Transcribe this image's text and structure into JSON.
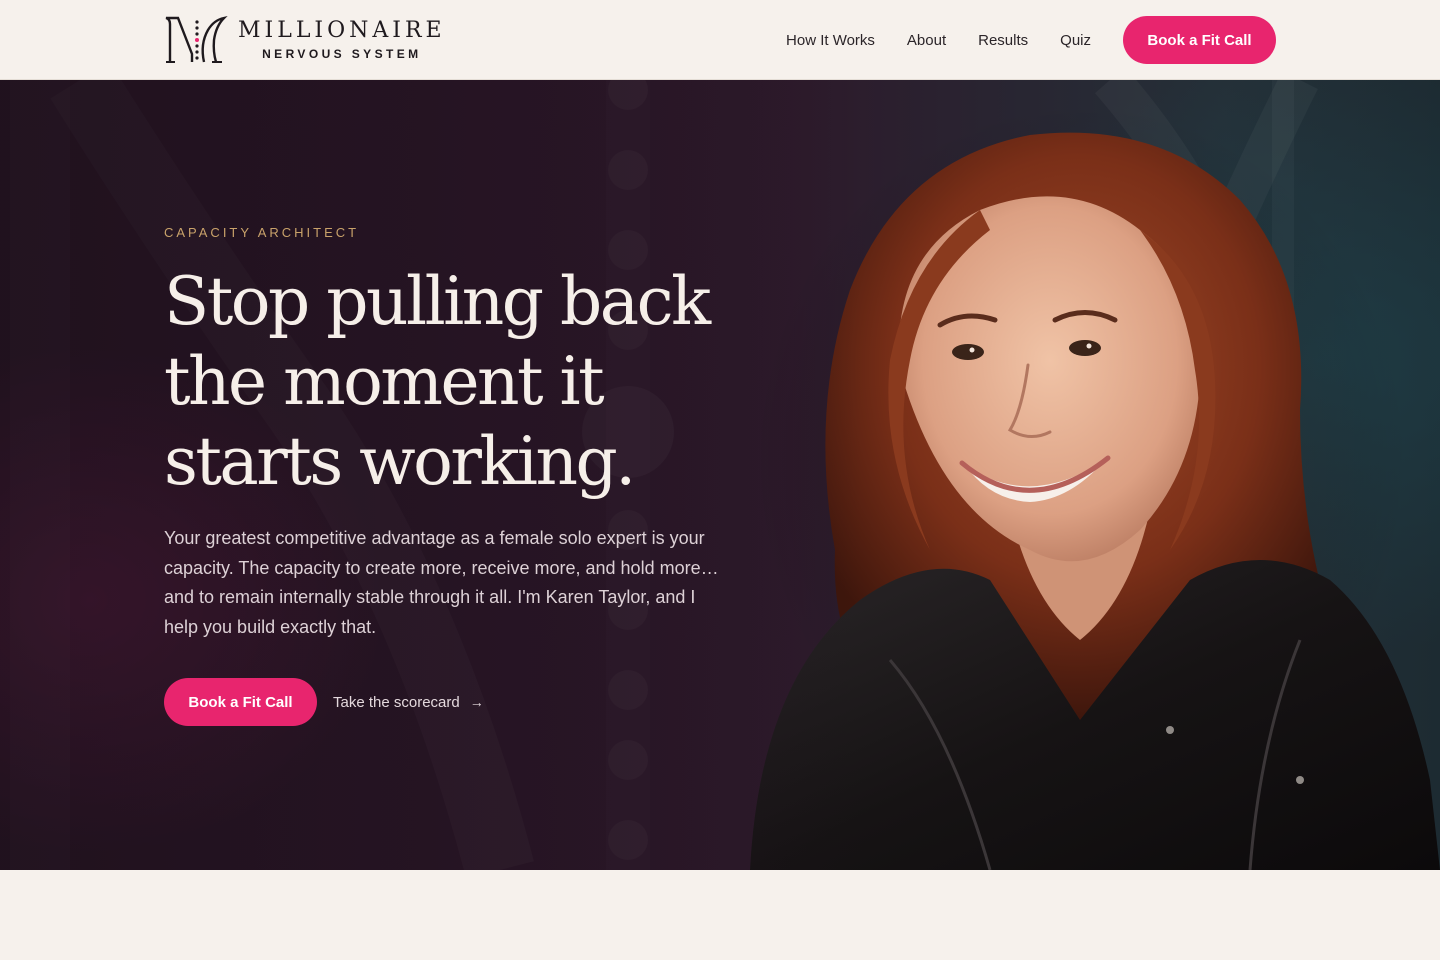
{
  "header": {
    "logo": {
      "wordmark": "MILLIONAIRE",
      "subtitle": "NERVOUS SYSTEM",
      "mark_letter": "M"
    },
    "nav": [
      {
        "label": "How It Works"
      },
      {
        "label": "About"
      },
      {
        "label": "Results"
      },
      {
        "label": "Quiz"
      }
    ],
    "cta_label": "Book a Fit Call"
  },
  "hero": {
    "eyebrow": "CAPACITY ARCHITECT",
    "headline": "Stop pulling back the moment it starts working.",
    "lede": "Your greatest competitive advantage as a female solo expert is your capacity. The capacity to create more, receive more, and hold more… and to remain internally stable through it all. I'm Karen Taylor, and I help you build exactly that.",
    "primary_cta": "Book a Fit Call",
    "secondary_cta": "Take the scorecard",
    "secondary_icon": "arrow-right-icon"
  },
  "colors": {
    "accent": "#e8256e",
    "eyebrow": "#c9a26a",
    "page_background": "#f6f1ec",
    "hero_background": "#1f121c"
  }
}
